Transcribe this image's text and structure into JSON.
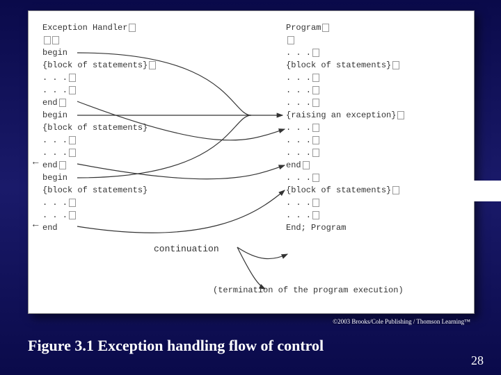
{
  "left": {
    "title": "Exception Handler",
    "blank": "",
    "begin": "  begin",
    "block": "  {block of statements}",
    "dots1": "  . . .",
    "dots2": "  . . .",
    "end": "  end"
  },
  "right": {
    "title": "Program",
    "blank": "",
    "dots": ". . .",
    "block": "{block of statements}",
    "raise": "{raising an exception}",
    "endp": "end",
    "endprog": "End; Program"
  },
  "labels": {
    "continuation": "continuation",
    "termination": "(termination of the program execution)"
  },
  "copyright": "©2003 Brooks/Cole Publishing / Thomson Learning™",
  "caption": "Figure 3.1  Exception handling flow of control",
  "page": "28"
}
